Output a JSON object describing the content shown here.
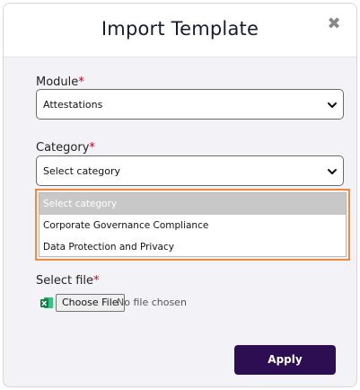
{
  "modal": {
    "title": "Import Template",
    "close_icon": "close-icon",
    "close_glyph": "✖"
  },
  "module": {
    "label": "Module",
    "required_mark": "*",
    "value": "Attestations"
  },
  "category": {
    "label": "Category",
    "required_mark": "*",
    "value": "Select category",
    "options": [
      "Select category",
      "Corporate Governance Compliance",
      "Data Protection and Privacy"
    ],
    "highlighted_option": "Select category"
  },
  "file": {
    "label": "Select file",
    "required_mark": "*",
    "icon": "excel-icon",
    "choose_label": "Choose File",
    "status": "No file chosen"
  },
  "footer": {
    "apply_label": "Apply"
  },
  "colors": {
    "accent_button": "#2d0e52",
    "highlight_border": "#f08a3c",
    "required": "#d0021b"
  }
}
